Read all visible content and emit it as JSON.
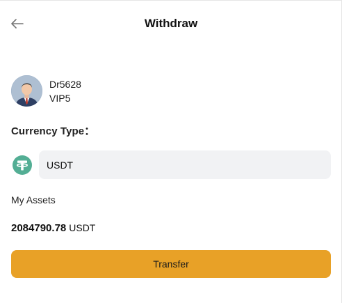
{
  "header": {
    "title": "Withdraw",
    "back_icon": "arrow-left-icon"
  },
  "user": {
    "name": "Dr5628",
    "level": "VIP5",
    "avatar_icon": "user-avatar"
  },
  "currency": {
    "label": "Currency Type：",
    "selected": "USDT",
    "icon": "tether-icon",
    "icon_color": "#53ae94"
  },
  "assets": {
    "label": "My Assets",
    "amount": "2084790.78",
    "unit": "USDT"
  },
  "actions": {
    "transfer_label": "Transfer",
    "button_color": "#e8a127"
  }
}
